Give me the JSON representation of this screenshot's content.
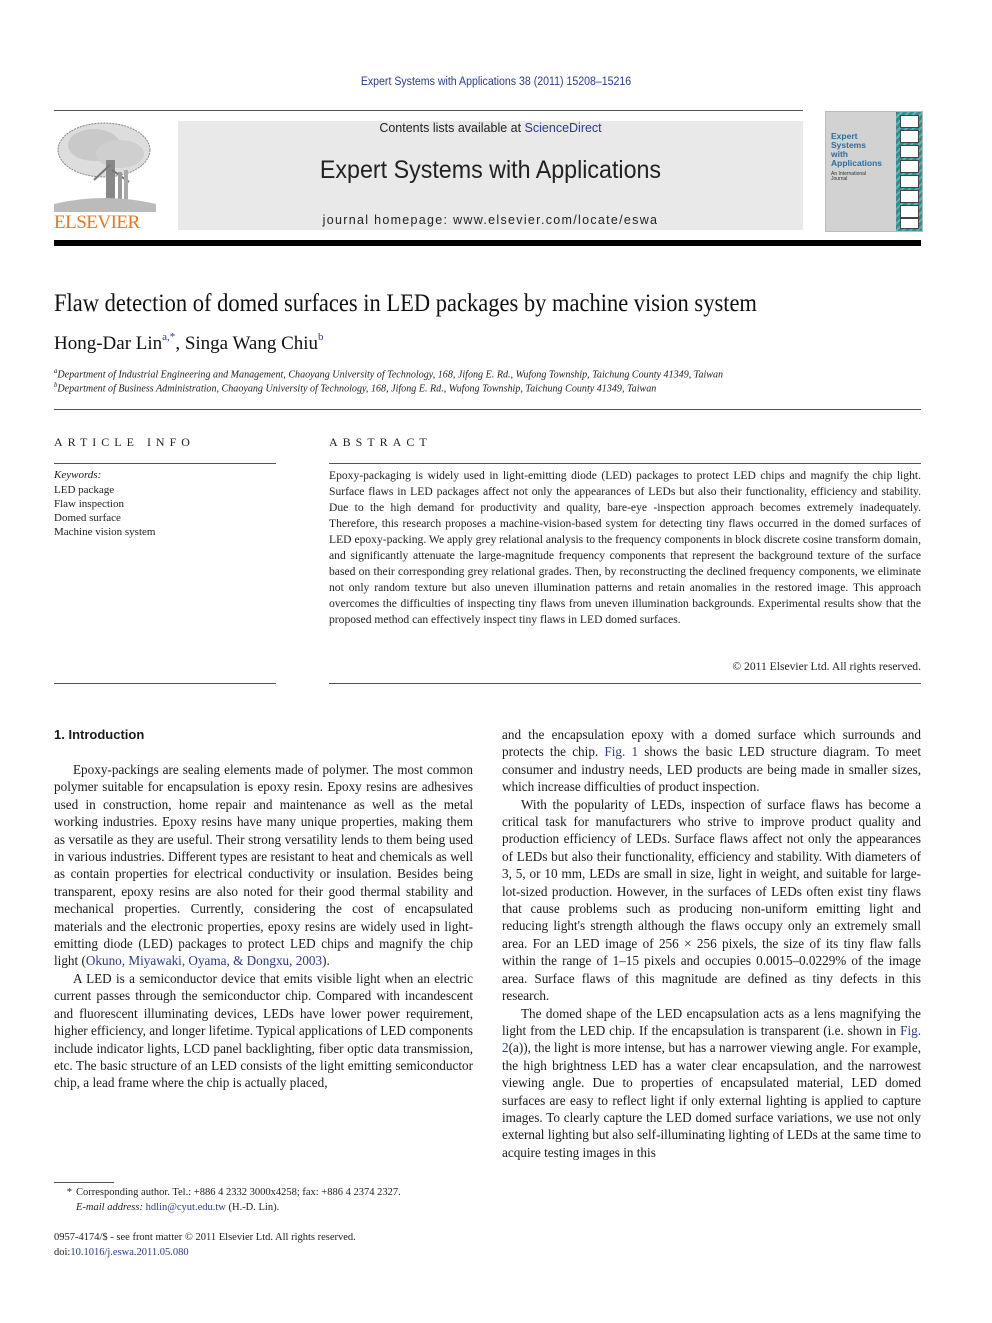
{
  "header": {
    "journal_citation": "Expert Systems with Applications 38 (2011) 15208–15216",
    "contents_prefix": "Contents lists available at ",
    "contents_link": "ScienceDirect",
    "journal_title": "Expert Systems with Applications",
    "homepage": "journal homepage: www.elsevier.com/locate/eswa",
    "publisher_wordmark": "ELSEVIER",
    "cover": {
      "title_lines": [
        "Expert",
        "Systems",
        "with",
        "Applications"
      ],
      "subtitle": "An International Journal"
    }
  },
  "article": {
    "title": "Flaw detection of domed surfaces in LED packages by machine vision system",
    "authors": [
      {
        "name": "Hong-Dar Lin",
        "sup": "a,*"
      },
      {
        "name": "Singa Wang Chiu",
        "sup": "b"
      }
    ],
    "author_separator": ", ",
    "affiliations": [
      {
        "mark": "a",
        "text": "Department of Industrial Engineering and Management, Chaoyang University of Technology, 168, Jifong E. Rd., Wufong Township, Taichung County 41349, Taiwan"
      },
      {
        "mark": "b",
        "text": "Department of Business Administration, Chaoyang University of Technology, 168, Jifong E. Rd., Wufong Township, Taichung County 41349, Taiwan"
      }
    ]
  },
  "article_info": {
    "heading": "ARTICLE INFO",
    "keywords_label": "Keywords:",
    "keywords": [
      "LED package",
      "Flaw inspection",
      "Domed surface",
      "Machine vision system"
    ]
  },
  "abstract": {
    "heading": "ABSTRACT",
    "text": "Epoxy-packaging is widely used in light-emitting diode (LED) packages to protect LED chips and magnify the chip light. Surface flaws in LED packages affect not only the appearances of LEDs but also their functionality, efficiency and stability. Due to the high demand for productivity and quality, bare-eye -inspection approach becomes extremely inadequately. Therefore, this research proposes a machine-vision-based system for detecting tiny flaws occurred in the domed surfaces of LED epoxy-packing. We apply grey relational analysis to the frequency components in block discrete cosine transform domain, and significantly attenuate the large-magnitude frequency components that represent the background texture of the surface based on their corresponding grey relational grades. Then, by reconstructing the declined frequency components, we eliminate not only random texture but also uneven illumination patterns and retain anomalies in the restored image. This approach overcomes the difficulties of inspecting tiny flaws from uneven illumination backgrounds. Experimental results show that the proposed method can effectively inspect tiny flaws in LED domed surfaces.",
    "copyright": "© 2011 Elsevier Ltd. All rights reserved."
  },
  "body": {
    "section_heading": "1. Introduction",
    "left_paragraphs": [
      {
        "before": "Epoxy-packings are sealing elements made of polymer. The most common polymer suitable for encapsulation is epoxy resin. Epoxy resins are adhesives used in construction, home repair and maintenance as well as the metal working industries. Epoxy resins have many unique properties, making them as versatile as they are useful. Their strong versatility lends to them being used in various industries. Different types are resistant to heat and chemicals as well as contain properties for electrical conductivity or insulation. Besides being transparent, epoxy resins are also noted for their good thermal stability and mechanical properties. Currently, considering the cost of encapsulated materials and the electronic properties, epoxy resins are widely used in light-emitting diode (LED) packages to protect LED chips and magnify the chip light (",
        "link": "Okuno, Miyawaki, Oyama, & Dongxu, 2003",
        "after": ")."
      },
      {
        "before": "A LED is a semiconductor device that emits visible light when an electric current passes through the semiconductor chip. Compared with incandescent and fluorescent illuminating devices, LEDs have lower power requirement, higher efficiency, and longer lifetime. Typical applications of LED components include indicator lights, LCD panel backlighting, fiber optic data transmission, etc. The basic structure of an LED consists of the light emitting semiconductor chip, a lead frame where the chip is actually placed,",
        "link": "",
        "after": ""
      }
    ],
    "right_paragraphs": [
      {
        "before": "and the encapsulation epoxy with a domed surface which surrounds and protects the chip. ",
        "link": "Fig. 1",
        "after": " shows the basic LED structure diagram. To meet consumer and industry needs, LED products are being made in smaller sizes, which increase difficulties of product inspection."
      },
      {
        "before": "With the popularity of LEDs, inspection of surface flaws has become a critical task for manufacturers who strive to improve product quality and production efficiency of LEDs. Surface flaws affect not only the appearances of LEDs but also their functionality, efficiency and stability. With diameters of 3, 5, or 10 mm, LEDs are small in size, light in weight, and suitable for large-lot-sized production. However, in the surfaces of LEDs often exist tiny flaws that cause problems such as producing non-uniform emitting light and reducing light's strength although the flaws occupy only an extremely small area. For an LED image of 256 × 256 pixels, the size of its tiny flaw falls within the range of 1–15 pixels and occupies 0.0015–0.0229% of the image area. Surface flaws of this magnitude are defined as tiny defects in this research.",
        "link": "",
        "after": ""
      },
      {
        "before": "The domed shape of the LED encapsulation acts as a lens magnifying the light from the LED chip. If the encapsulation is transparent (i.e. shown in ",
        "link": "Fig. 2",
        "after": "(a)), the light is more intense, but has a narrower viewing angle. For example, the high brightness LED has a water clear encapsulation, and the narrowest viewing angle. Due to properties of encapsulated material, LED domed surfaces are easy to reflect light if only external lighting is applied to capture images. To clearly capture the LED domed surface variations, we use not only external lighting but also self-illuminating lighting of LEDs at the same time to acquire testing images in this"
      }
    ]
  },
  "footer": {
    "corresponding_mark": "*",
    "corresponding_text": "Corresponding author. Tel.: +886 4 2332 3000x4258; fax: +886 4 2374 2327.",
    "email_label": "E-mail address:",
    "email": "hdlin@cyut.edu.tw",
    "email_suffix": " (H.-D. Lin).",
    "issn_line": "0957-4174/$ - see front matter © 2011 Elsevier Ltd. All rights reserved.",
    "doi_prefix": "doi:",
    "doi": "10.1016/j.eswa.2011.05.080"
  },
  "colors": {
    "link": "#2b3a8c",
    "elsevier_orange": "#e87722",
    "masthead_bg": "#e9e9e9",
    "cover_teal": "#2f8e93"
  }
}
